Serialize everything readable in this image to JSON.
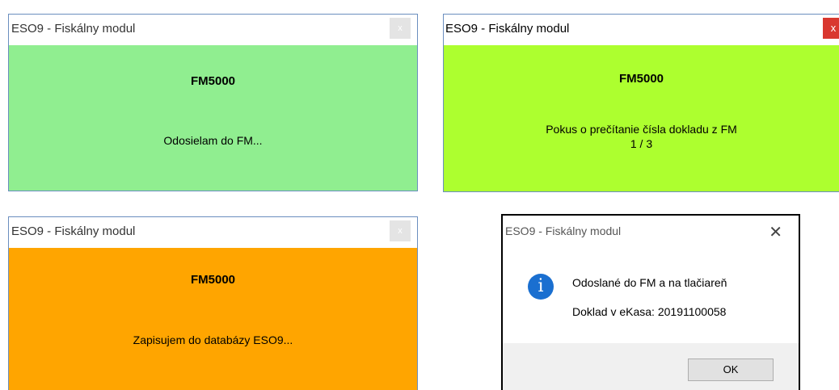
{
  "windows": [
    {
      "title": "ESO9 - Fiskálny modul",
      "close_label": "x",
      "heading": "FM5000",
      "message": "Odosielam do FM...",
      "background": "#90ee90"
    },
    {
      "title": "ESO9 - Fiskálny modul",
      "close_label": "x",
      "heading": "FM5000",
      "message": "Pokus o prečítanie čísla dokladu z FM",
      "message_line2": "1 / 3",
      "background": "#adff2f"
    },
    {
      "title": "ESO9 - Fiskálny modul",
      "close_label": "x",
      "heading": "FM5000",
      "message": "Zapisujem do databázy ESO9...",
      "background": "#ffa500"
    }
  ],
  "message_box": {
    "title": "ESO9 - Fiskálny modul",
    "close_label": "✕",
    "icon": "info-icon",
    "icon_glyph": "i",
    "line1": "Odoslané do FM a na tlačiareň",
    "line2": "Doklad v eKasa: 20191100058",
    "ok_label": "OK"
  },
  "colors": {
    "icon_blue": "#1a6fd0",
    "close_red": "#d9372f"
  }
}
